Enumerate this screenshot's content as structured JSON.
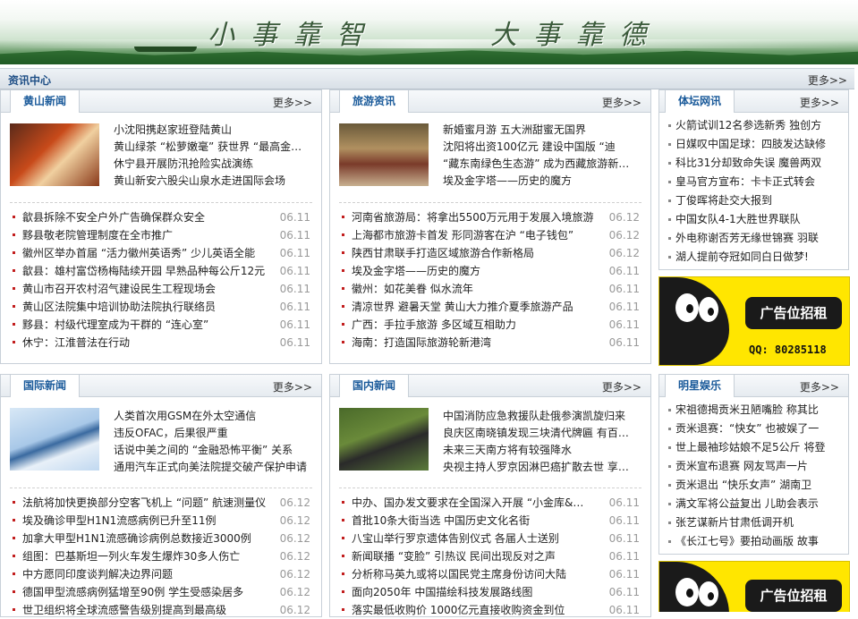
{
  "banner": {
    "slogan_left": "小事靠智",
    "slogan_right": "大事靠德"
  },
  "section": {
    "title": "资讯中心",
    "more": "更多>>"
  },
  "panels": {
    "huangshan": {
      "tab": "黄山新闻",
      "more": "更多>>",
      "top": [
        "小沈阳携赵家班登陆黄山",
        "黄山绿茶 “松萝嫩毫” 获世界 “最高金…",
        "休宁县开展防汛抢险实战演练",
        "黄山新安六股尖山泉水走进国际会场"
      ],
      "list": [
        {
          "t": "歙县拆除不安全户外广告确保群众安全",
          "d": "06.11"
        },
        {
          "t": "黟县敬老院管理制度在全市推广",
          "d": "06.11"
        },
        {
          "t": "徽州区举办首届 “活力徽州英语秀” 少儿英语全能",
          "d": "06.11"
        },
        {
          "t": "歙县：雄村富岱杨梅陆续开园 早熟品种每公斤12元",
          "d": "06.11"
        },
        {
          "t": "黄山市召开农村沼气建设民生工程现场会",
          "d": "06.11"
        },
        {
          "t": "黄山区法院集中培训协助法院执行联络员",
          "d": "06.11"
        },
        {
          "t": "黟县：村级代理室成为干群的 “连心室”",
          "d": "06.11"
        },
        {
          "t": "休宁：江淮普法在行动",
          "d": "06.11"
        }
      ]
    },
    "lvyou": {
      "tab": "旅游资讯",
      "more": "更多>>",
      "top": [
        "新婚蜜月游 五大洲甜蜜无国界",
        "沈阳将出资100亿元 建设中国版 “迪",
        "“藏东南绿色生态游” 成为西藏旅游新…",
        "埃及金字塔——历史的魔方"
      ],
      "list": [
        {
          "t": "河南省旅游局：将拿出5500万元用于发展入境旅游",
          "d": "06.12"
        },
        {
          "t": "上海都市旅游卡首发 形同游客在沪 “电子钱包”",
          "d": "06.12"
        },
        {
          "t": "陕西甘肃联手打造区域旅游合作新格局",
          "d": "06.12"
        },
        {
          "t": "埃及金字塔——历史的魔方",
          "d": "06.11"
        },
        {
          "t": "徽州：如花美眷 似水流年",
          "d": "06.11"
        },
        {
          "t": "清凉世界 避暑天堂 黄山大力推介夏季旅游产品",
          "d": "06.11"
        },
        {
          "t": "广西：手拉手旅游 多区域互相助力",
          "d": "06.11"
        },
        {
          "t": "海南：打造国际旅游轮新港湾",
          "d": "06.11"
        }
      ]
    },
    "tiyu": {
      "tab": "体坛网讯",
      "more": "更多>>",
      "list": [
        "火箭试训12名参选新秀 独创方",
        "日媒叹中国足球：四肢发达缺修",
        "科比31分却致命失误 魔兽两双",
        "皇马官方宣布：卡卡正式转会",
        "丁俊晖将赴交大报到",
        "中国女队4-1大胜世界联队",
        "外电称谢否芳无缘世锦赛 羽联",
        "湖人提前夺冠如同白日做梦!"
      ]
    },
    "guoji": {
      "tab": "国际新闻",
      "more": "更多>>",
      "top": [
        "人类首次用GSM在外太空通信",
        "违反OFAC，后果很严重",
        "话说中美之间的 “金融恐怖平衡” 关系",
        "通用汽车正式向美法院提交破产保护申请"
      ],
      "list": [
        {
          "t": "法航将加快更换部分空客飞机上 “问题” 航速测量仪",
          "d": "06.12"
        },
        {
          "t": "埃及确诊甲型H1N1流感病例已升至11例",
          "d": "06.12"
        },
        {
          "t": "加拿大甲型H1N1流感确诊病例总数接近3000例",
          "d": "06.12"
        },
        {
          "t": "组图：巴基斯坦一列火车发生爆炸30多人伤亡",
          "d": "06.12"
        },
        {
          "t": "中方愿同印度谈判解决边界问题",
          "d": "06.12"
        },
        {
          "t": "德国甲型流感病例猛增至90例 学生受感染居多",
          "d": "06.12"
        },
        {
          "t": "世卫组织将全球流感警告级别提高到最高级",
          "d": "06.12"
        }
      ]
    },
    "guonei": {
      "tab": "国内新闻",
      "more": "更多>>",
      "top": [
        "中国消防应急救援队赴俄参演凯旋归来",
        "良庆区南晓镇发现三块清代牌匾 有百…",
        "未来三天南方将有较强降水",
        "央视主持人罗京因淋巴癌扩散去世 享…"
      ],
      "list": [
        {
          "t": "中办、国办发文要求在全国深入开展 “小金库&…",
          "d": "06.11"
        },
        {
          "t": "首批10条大街当选 中国历史文化名街",
          "d": "06.11"
        },
        {
          "t": "八宝山举行罗京遗体告别仪式 各届人士送别",
          "d": "06.11"
        },
        {
          "t": "新闻联播 “变脸” 引热议 民间出现反对之声",
          "d": "06.11"
        },
        {
          "t": "分析称马英九或将以国民党主席身份访问大陆",
          "d": "06.11"
        },
        {
          "t": "面向2050年 中国描绘科技发展路线图",
          "d": "06.11"
        },
        {
          "t": "落实最低收购价 1000亿元直接收购资金到位",
          "d": "06.11"
        }
      ]
    },
    "mingxing": {
      "tab": "明星娱乐",
      "more": "更多>>",
      "list": [
        "宋祖德揭贡米丑陋嘴脸 称其比",
        "贡米退赛：“快女” 也被娱了一",
        "世上最袖珍姑娘不足5公斤 将登",
        "贡米宣布退赛 网友骂声一片",
        "贡米退出 “快乐女声” 湖南卫",
        "满文军将公益复出 儿助会表示",
        "张艺谋新片甘肃低调开机",
        "《长江七号》要拍动画版 故事"
      ]
    }
  },
  "ads": [
    {
      "text": "广告位招租",
      "qq": "QQ: 80285118"
    },
    {
      "text": "广告位招租"
    }
  ]
}
